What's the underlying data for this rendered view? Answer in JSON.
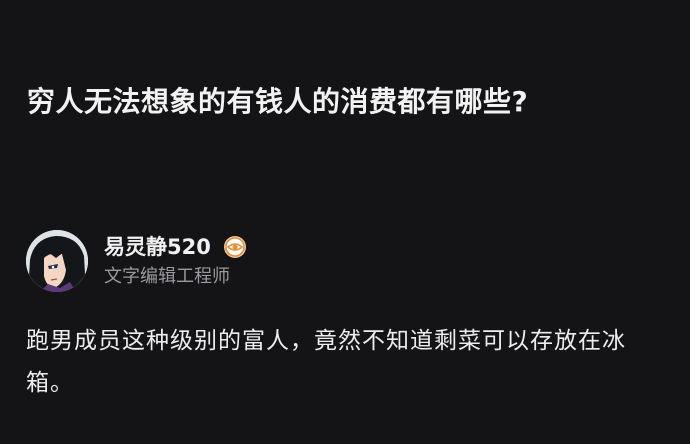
{
  "question": {
    "title": "穷人无法想象的有钱人的消费都有哪些?"
  },
  "author": {
    "name": "易灵静520",
    "title": "文字编辑工程师",
    "avatar_icon": "anime-character-avatar",
    "badge_icon": "eye-badge-icon",
    "badge_color": "#e8913a"
  },
  "answer": {
    "text": "跑男成员这种级别的富人，竟然不知道剩菜可以存放在冰箱。"
  },
  "colors": {
    "background": "#141416",
    "primary_text": "#ededed",
    "secondary_text": "#9a9a9e"
  }
}
